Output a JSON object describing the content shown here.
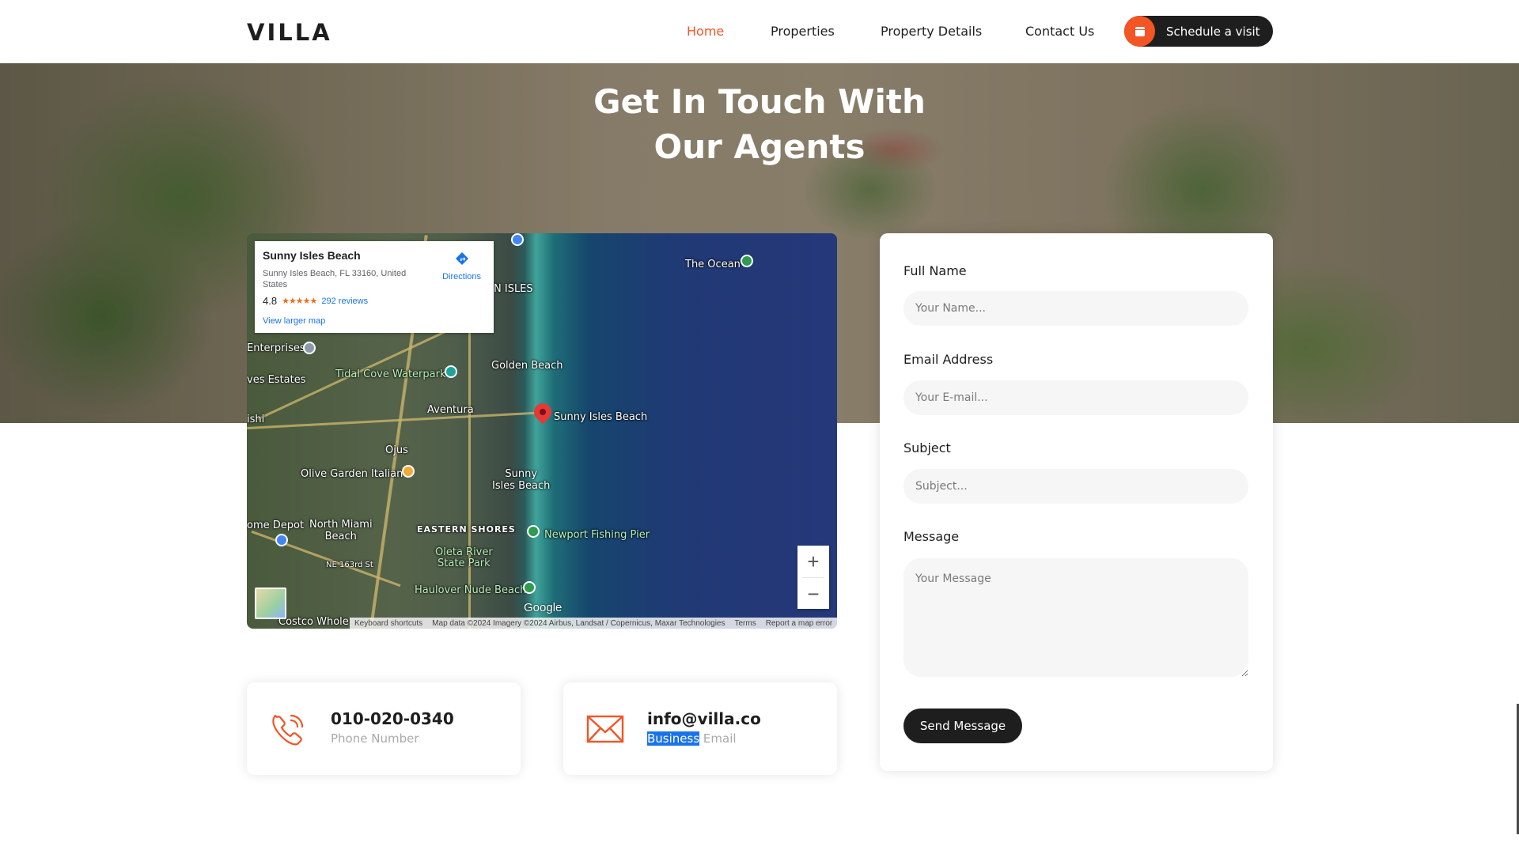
{
  "nav": {
    "logo": "VILLA",
    "links": [
      {
        "label": "Home",
        "active": true
      },
      {
        "label": "Properties",
        "active": false
      },
      {
        "label": "Property Details",
        "active": false
      },
      {
        "label": "Contact Us",
        "active": false
      }
    ],
    "cta_label": "Schedule a visit",
    "cta_icon": "calendar-icon"
  },
  "hero": {
    "title_line1": "Get In Touch With",
    "title_line2": "Our Agents"
  },
  "map": {
    "place_name": "Sunny Isles Beach",
    "address": "Sunny Isles Beach, FL 33160, United States",
    "rating": "4.8",
    "stars": "★★★★★",
    "reviews": "292 reviews",
    "larger_map": "View larger map",
    "directions": "Directions",
    "labels": {
      "ocean": "The Ocean",
      "golden_beach": "Golden Beach",
      "sunny_isles": "Sunny Isles Beach",
      "sunny_isles_beach2": "Sunny\nIsles Beach",
      "aventura": "Aventura",
      "ojus": "Ojus",
      "olive_garden": "Olive Garden Italian",
      "tidal_cove": "Tidal Cove Waterpark",
      "ives_estates": "ves Estates",
      "enterprises": "Enterprises",
      "n_isles": "N ISLES",
      "eastern_shores": "EASTERN SHORES",
      "newport": "Newport Fishing Pier",
      "oleta": "Oleta River\nState Park",
      "north_miami": "North Miami\nBeach",
      "home_depot": "ome Depot",
      "haulover": "Haulover Nude Beach",
      "costco": "Costco Whole",
      "ne163": "NE 163rd St",
      "ishi": "ishi"
    },
    "google": "Google",
    "attribution": {
      "shortcuts": "Keyboard shortcuts",
      "data": "Map data ©2024 Imagery ©2024 Airbus, Landsat / Copernicus, Maxar Technologies",
      "terms": "Terms",
      "report": "Report a map error"
    }
  },
  "form": {
    "full_name_label": "Full Name",
    "full_name_placeholder": "Your Name...",
    "email_label": "Email Address",
    "email_placeholder": "Your E-mail...",
    "subject_label": "Subject",
    "subject_placeholder": "Subject...",
    "message_label": "Message",
    "message_placeholder": "Your Message",
    "submit_label": "Send Message"
  },
  "contacts": {
    "phone": {
      "value": "010-020-0340",
      "label": "Phone Number",
      "icon": "phone-icon"
    },
    "email": {
      "value": "info@villa.co",
      "label_selected": "Business",
      "label_rest": " Email",
      "icon": "envelope-icon"
    }
  },
  "colors": {
    "accent": "#f35525",
    "dark": "#1e1e1e",
    "link_blue": "#1a73e8"
  }
}
